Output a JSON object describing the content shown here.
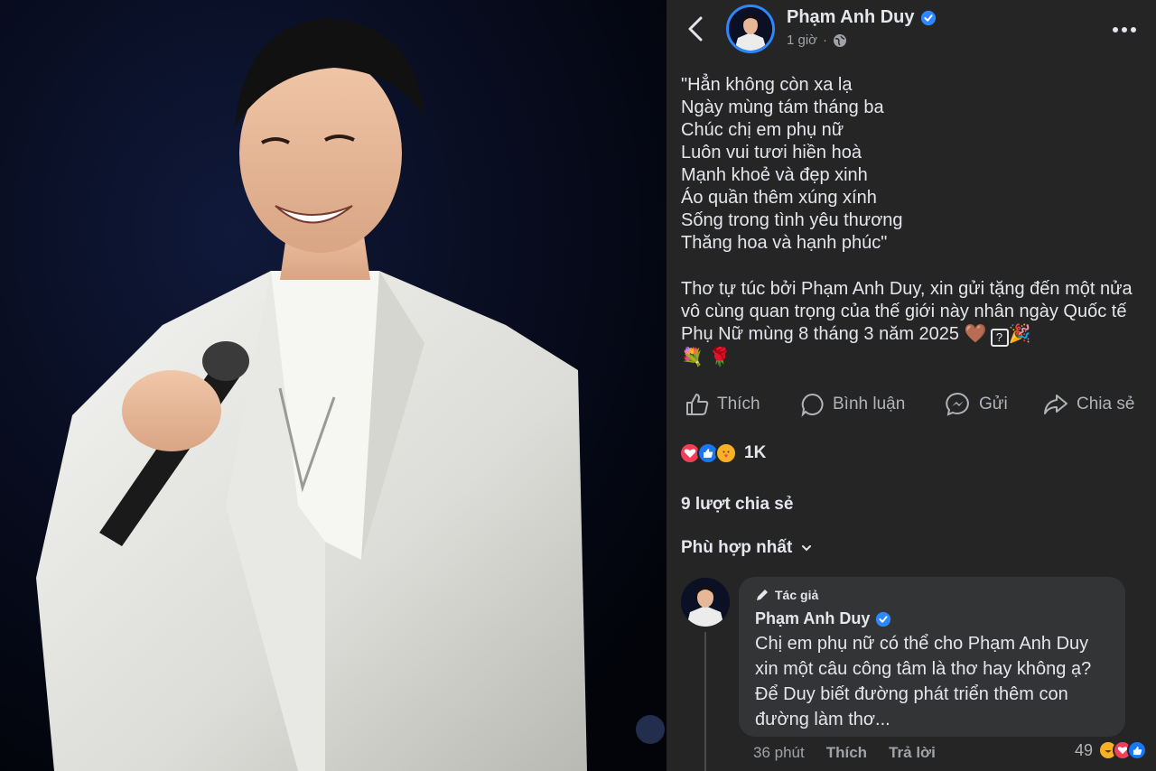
{
  "post": {
    "author": "Phạm Anh Duy",
    "time": "1 giờ",
    "separator": "·",
    "poem": "\"Hẳn không còn xa lạ\nNgày mùng tám tháng ba\nChúc chị em phụ nữ\nLuôn vui tươi hiền hoà\nMạnh khoẻ và đẹp xinh\nÁo quần thêm xúng xính\nSống trong tình yêu thương\nThăng hoa và hạnh phúc\"",
    "caption": "Thơ tự túc bởi Phạm Anh Duy, xin gửi tặng đến một nửa vô cùng quan trọng của thế giới này nhân ngày Quốc tế Phụ Nữ mùng 8 tháng 3 năm 2025",
    "caption_emoji_1": "🤎",
    "caption_qbox": "?",
    "caption_emoji_2": "🎉",
    "caption_emoji_3": "💐",
    "caption_emoji_4": "🌹"
  },
  "actions": {
    "like": "Thích",
    "comment": "Bình luận",
    "send": "Gửi",
    "share": "Chia sẻ"
  },
  "stats": {
    "reaction_count": "1K",
    "shares": "9 lượt chia sẻ"
  },
  "sort_label": "Phù hợp nhất",
  "comment": {
    "author_tag": "Tác giả",
    "author": "Phạm Anh Duy",
    "text": "Chị em phụ nữ có thể cho Phạm Anh Duy xin một câu công tâm là thơ hay không ạ? Để Duy biết đường phát triển thêm con đường làm thơ...",
    "time": "36 phút",
    "like": "Thích",
    "reply": "Trả lời",
    "reaction_count": "49"
  },
  "colors": {
    "panel_bg": "#252526",
    "accent": "#2d88ff",
    "text": "#e4e6eb",
    "muted": "#a0a3a8"
  }
}
